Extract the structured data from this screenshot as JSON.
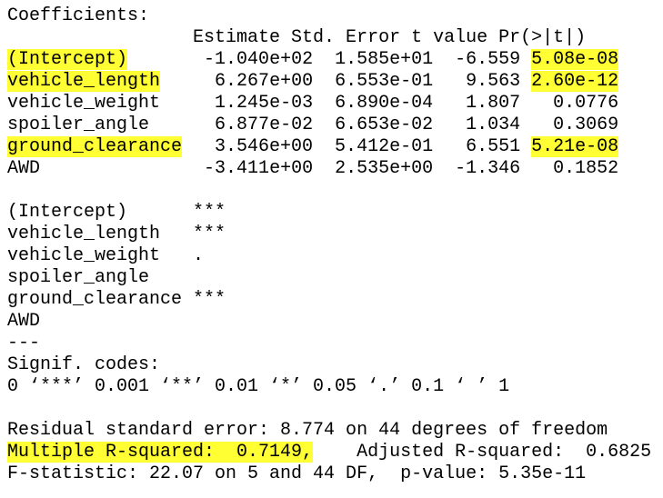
{
  "colors": {
    "text": "#000000",
    "background": "#ffffff",
    "highlight": "#ffff33"
  },
  "output": {
    "coefficients_title": "Coefficients:",
    "header": "                 Estimate Std. Error t value Pr(>|t|)",
    "rows": [
      {
        "term": "(Intercept)",
        "term_pad": "     ",
        "stats": "  -1.040e+02  1.585e+01  -6.559 ",
        "p": "5.08e-08",
        "highlight_term": true,
        "highlight_p": true
      },
      {
        "term": "vehicle_length",
        "term_pad": "  ",
        "stats": "   6.267e+00  6.553e-01   9.563 ",
        "p": "2.60e-12",
        "highlight_term": true,
        "highlight_p": true
      },
      {
        "term": "vehicle_weight",
        "term_pad": "  ",
        "stats": "   1.245e-03  6.890e-04   1.807 ",
        "p": "  0.0776",
        "highlight_term": false,
        "highlight_p": false
      },
      {
        "term": "spoiler_angle",
        "term_pad": "   ",
        "stats": "   6.877e-02  6.653e-02   1.034 ",
        "p": "  0.3069",
        "highlight_term": false,
        "highlight_p": false
      },
      {
        "term": "ground_clearance",
        "term_pad": "",
        "stats": "   3.546e+00  5.412e-01   6.551 ",
        "p": "5.21e-08",
        "highlight_term": true,
        "highlight_p": true
      },
      {
        "term": "AWD",
        "term_pad": "             ",
        "stats": "  -3.411e+00  2.535e+00  -1.346 ",
        "p": "  0.1852",
        "highlight_term": false,
        "highlight_p": false
      }
    ],
    "signif_rows": [
      {
        "term": "(Intercept)",
        "stars": "      ***"
      },
      {
        "term": "vehicle_length",
        "stars": "   ***"
      },
      {
        "term": "vehicle_weight",
        "stars": "   ."
      },
      {
        "term": "spoiler_angle",
        "stars": ""
      },
      {
        "term": "ground_clearance",
        "stars": " ***"
      },
      {
        "term": "AWD",
        "stars": ""
      }
    ],
    "separator": "---",
    "signif_label": "Signif. codes:",
    "signif_codes": "0 ‘***’ 0.001 ‘**’ 0.01 ‘*’ 0.05 ‘.’ 0.1 ‘ ’ 1",
    "residual_se": "Residual standard error: 8.774 on 44 degrees of freedom",
    "multiple_r2": "Multiple R-squared:  0.7149,",
    "adjusted_r2": "    Adjusted R-squared:  0.6825",
    "f_stat": "F-statistic: 22.07 on 5 and 44 DF,  p-value: 5.35e-11"
  }
}
